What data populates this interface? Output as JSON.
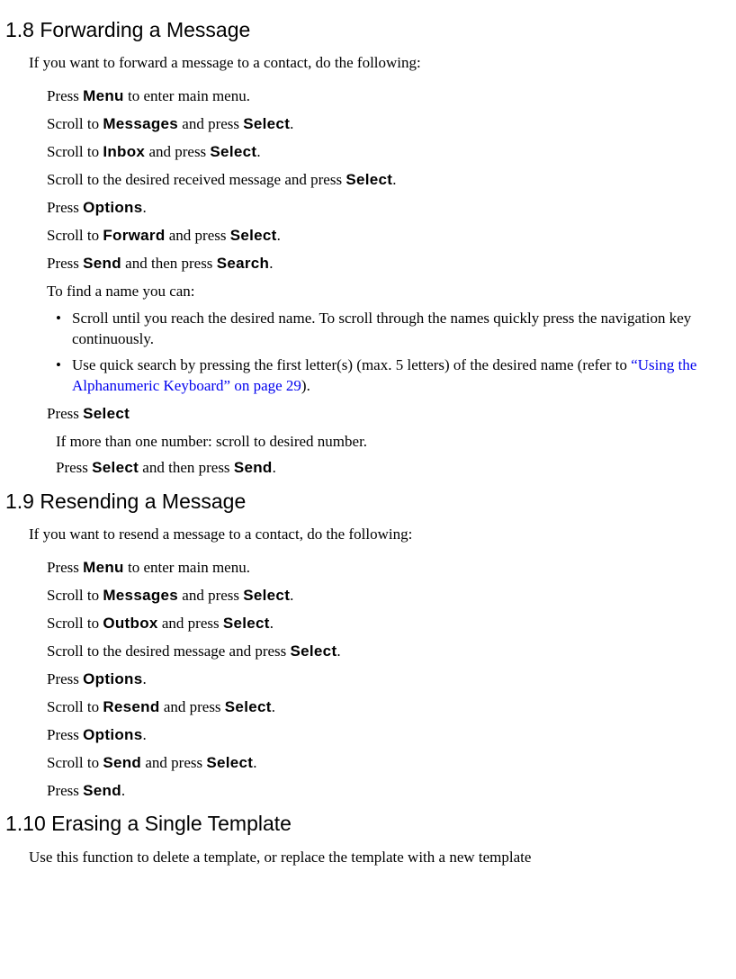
{
  "section18": {
    "heading": "1.8  Forwarding a Message",
    "intro": "If you want to forward a message to a contact, do the following:",
    "s1_a": "Press ",
    "s1_b": "Menu",
    "s1_c": " to enter main menu.",
    "s2_a": "Scroll to ",
    "s2_b": "Messages",
    "s2_c": " and press ",
    "s2_d": "Select",
    "s2_e": ".",
    "s3_a": "Scroll to ",
    "s3_b": "Inbox",
    "s3_c": " and press ",
    "s3_d": "Select",
    "s3_e": ".",
    "s4_a": "Scroll to the desired received message and press ",
    "s4_b": "Select",
    "s4_c": ".",
    "s5_a": "Press ",
    "s5_b": "Options",
    "s5_c": ".",
    "s6_a": "Scroll to ",
    "s6_b": "Forward",
    "s6_c": " and press ",
    "s6_d": "Select",
    "s6_e": ".",
    "s7_a": "Press ",
    "s7_b": "Send",
    "s7_c": " and then press ",
    "s7_d": "Search",
    "s7_e": ".",
    "s8": "To find a name you can:",
    "b1": "Scroll until you reach the desired name. To scroll through the names quickly press the navigation key continuously.",
    "b2_a": "Use quick search by pressing the first letter(s) (max. 5 letters) of the desired name (refer to ",
    "b2_link": "“Using the Alphanumeric Keyboard” on page 29",
    "b2_b": ").",
    "s9_a": "Press ",
    "s9_b": "Select",
    "s10": "If more than one number: scroll to desired number.",
    "s11_a": "Press ",
    "s11_b": "Select",
    "s11_c": " and then press ",
    "s11_d": "Send",
    "s11_e": "."
  },
  "section19": {
    "heading": "1.9  Resending a Message",
    "intro": "If you want to resend a message to a contact, do the following:",
    "s1_a": "Press ",
    "s1_b": "Menu",
    "s1_c": " to enter main menu.",
    "s2_a": "Scroll to ",
    "s2_b": "Messages",
    "s2_c": " and press ",
    "s2_d": "Select",
    "s2_e": ".",
    "s3_a": "Scroll to ",
    "s3_b": "Outbox",
    "s3_c": " and press ",
    "s3_d": "Select",
    "s3_e": ".",
    "s4_a": "Scroll to the desired message and press ",
    "s4_b": "Select",
    "s4_c": ".",
    "s5_a": "Press ",
    "s5_b": "Options",
    "s5_c": ".",
    "s6_a": "Scroll to ",
    "s6_b": "Resend",
    "s6_c": " and press ",
    "s6_d": "Select",
    "s6_e": ".",
    "s7_a": "Press ",
    "s7_b": "Options",
    "s7_c": ".",
    "s8_a": "Scroll to ",
    "s8_b": "Send",
    "s8_c": " and press ",
    "s8_d": "Select",
    "s8_e": ".",
    "s9_a": "Press ",
    "s9_b": "Send",
    "s9_c": "."
  },
  "section110": {
    "heading": "1.10  Erasing a Single Template",
    "intro": "Use this function to delete a template, or replace the template with a new template"
  }
}
